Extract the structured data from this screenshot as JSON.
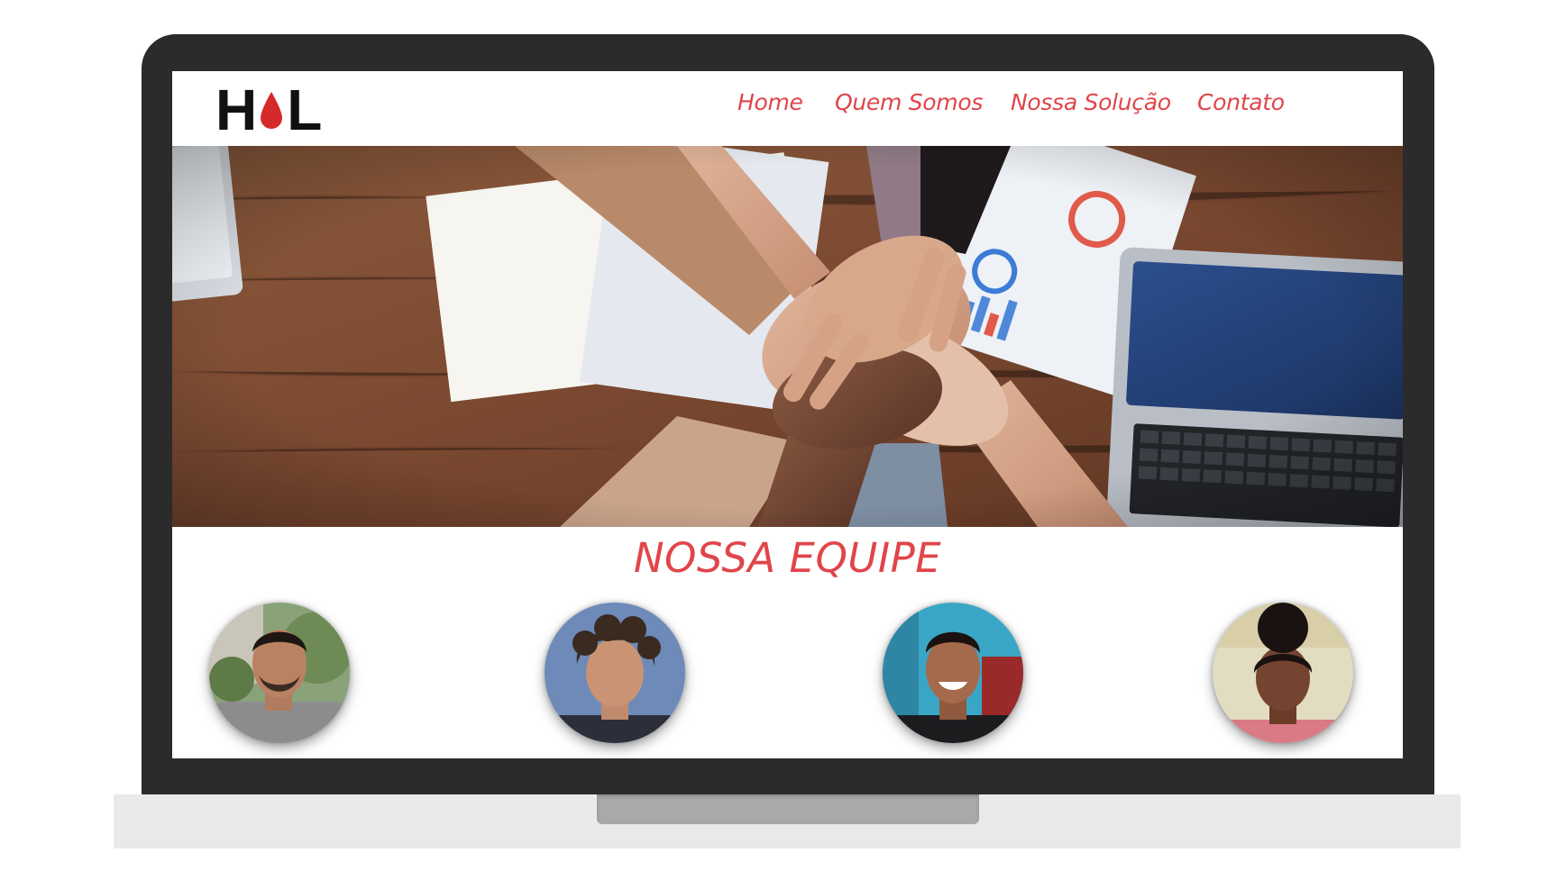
{
  "header": {
    "logo_text_left": "H",
    "logo_text_right": "L",
    "brand_color": "#e0454a"
  },
  "nav": {
    "items": [
      {
        "label": "Home"
      },
      {
        "label": "Quem Somos"
      },
      {
        "label": "Nossa Solução"
      },
      {
        "label": "Contato"
      }
    ]
  },
  "hero": {
    "icon": "team-hands-photo"
  },
  "team": {
    "title": "NOSSA EQUIPE",
    "members_count_shown": 4
  }
}
